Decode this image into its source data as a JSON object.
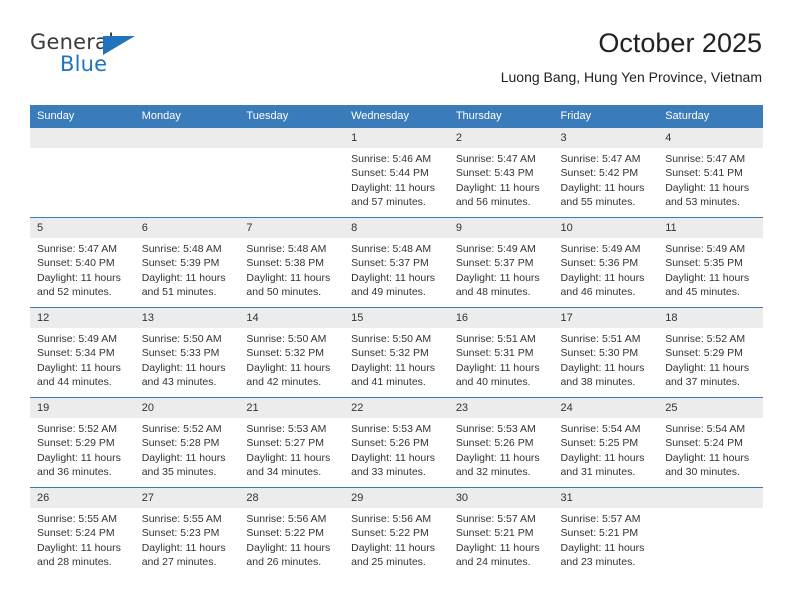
{
  "brand": {
    "name_part1": "General",
    "name_part2": "Blue",
    "accent_color": "#1f74bd"
  },
  "header": {
    "title": "October 2025",
    "subtitle": "Luong Bang, Hung Yen Province, Vietnam"
  },
  "calendar": {
    "header_bg": "#3a7cba",
    "daynum_bg": "#ececec",
    "weekday_headers": [
      "Sunday",
      "Monday",
      "Tuesday",
      "Wednesday",
      "Thursday",
      "Friday",
      "Saturday"
    ],
    "weeks": [
      [
        {
          "day": "",
          "sunrise": "",
          "sunset": "",
          "daylight_line1": "",
          "daylight_line2": ""
        },
        {
          "day": "",
          "sunrise": "",
          "sunset": "",
          "daylight_line1": "",
          "daylight_line2": ""
        },
        {
          "day": "",
          "sunrise": "",
          "sunset": "",
          "daylight_line1": "",
          "daylight_line2": ""
        },
        {
          "day": "1",
          "sunrise": "Sunrise: 5:46 AM",
          "sunset": "Sunset: 5:44 PM",
          "daylight_line1": "Daylight: 11 hours",
          "daylight_line2": "and 57 minutes."
        },
        {
          "day": "2",
          "sunrise": "Sunrise: 5:47 AM",
          "sunset": "Sunset: 5:43 PM",
          "daylight_line1": "Daylight: 11 hours",
          "daylight_line2": "and 56 minutes."
        },
        {
          "day": "3",
          "sunrise": "Sunrise: 5:47 AM",
          "sunset": "Sunset: 5:42 PM",
          "daylight_line1": "Daylight: 11 hours",
          "daylight_line2": "and 55 minutes."
        },
        {
          "day": "4",
          "sunrise": "Sunrise: 5:47 AM",
          "sunset": "Sunset: 5:41 PM",
          "daylight_line1": "Daylight: 11 hours",
          "daylight_line2": "and 53 minutes."
        }
      ],
      [
        {
          "day": "5",
          "sunrise": "Sunrise: 5:47 AM",
          "sunset": "Sunset: 5:40 PM",
          "daylight_line1": "Daylight: 11 hours",
          "daylight_line2": "and 52 minutes."
        },
        {
          "day": "6",
          "sunrise": "Sunrise: 5:48 AM",
          "sunset": "Sunset: 5:39 PM",
          "daylight_line1": "Daylight: 11 hours",
          "daylight_line2": "and 51 minutes."
        },
        {
          "day": "7",
          "sunrise": "Sunrise: 5:48 AM",
          "sunset": "Sunset: 5:38 PM",
          "daylight_line1": "Daylight: 11 hours",
          "daylight_line2": "and 50 minutes."
        },
        {
          "day": "8",
          "sunrise": "Sunrise: 5:48 AM",
          "sunset": "Sunset: 5:37 PM",
          "daylight_line1": "Daylight: 11 hours",
          "daylight_line2": "and 49 minutes."
        },
        {
          "day": "9",
          "sunrise": "Sunrise: 5:49 AM",
          "sunset": "Sunset: 5:37 PM",
          "daylight_line1": "Daylight: 11 hours",
          "daylight_line2": "and 48 minutes."
        },
        {
          "day": "10",
          "sunrise": "Sunrise: 5:49 AM",
          "sunset": "Sunset: 5:36 PM",
          "daylight_line1": "Daylight: 11 hours",
          "daylight_line2": "and 46 minutes."
        },
        {
          "day": "11",
          "sunrise": "Sunrise: 5:49 AM",
          "sunset": "Sunset: 5:35 PM",
          "daylight_line1": "Daylight: 11 hours",
          "daylight_line2": "and 45 minutes."
        }
      ],
      [
        {
          "day": "12",
          "sunrise": "Sunrise: 5:49 AM",
          "sunset": "Sunset: 5:34 PM",
          "daylight_line1": "Daylight: 11 hours",
          "daylight_line2": "and 44 minutes."
        },
        {
          "day": "13",
          "sunrise": "Sunrise: 5:50 AM",
          "sunset": "Sunset: 5:33 PM",
          "daylight_line1": "Daylight: 11 hours",
          "daylight_line2": "and 43 minutes."
        },
        {
          "day": "14",
          "sunrise": "Sunrise: 5:50 AM",
          "sunset": "Sunset: 5:32 PM",
          "daylight_line1": "Daylight: 11 hours",
          "daylight_line2": "and 42 minutes."
        },
        {
          "day": "15",
          "sunrise": "Sunrise: 5:50 AM",
          "sunset": "Sunset: 5:32 PM",
          "daylight_line1": "Daylight: 11 hours",
          "daylight_line2": "and 41 minutes."
        },
        {
          "day": "16",
          "sunrise": "Sunrise: 5:51 AM",
          "sunset": "Sunset: 5:31 PM",
          "daylight_line1": "Daylight: 11 hours",
          "daylight_line2": "and 40 minutes."
        },
        {
          "day": "17",
          "sunrise": "Sunrise: 5:51 AM",
          "sunset": "Sunset: 5:30 PM",
          "daylight_line1": "Daylight: 11 hours",
          "daylight_line2": "and 38 minutes."
        },
        {
          "day": "18",
          "sunrise": "Sunrise: 5:52 AM",
          "sunset": "Sunset: 5:29 PM",
          "daylight_line1": "Daylight: 11 hours",
          "daylight_line2": "and 37 minutes."
        }
      ],
      [
        {
          "day": "19",
          "sunrise": "Sunrise: 5:52 AM",
          "sunset": "Sunset: 5:29 PM",
          "daylight_line1": "Daylight: 11 hours",
          "daylight_line2": "and 36 minutes."
        },
        {
          "day": "20",
          "sunrise": "Sunrise: 5:52 AM",
          "sunset": "Sunset: 5:28 PM",
          "daylight_line1": "Daylight: 11 hours",
          "daylight_line2": "and 35 minutes."
        },
        {
          "day": "21",
          "sunrise": "Sunrise: 5:53 AM",
          "sunset": "Sunset: 5:27 PM",
          "daylight_line1": "Daylight: 11 hours",
          "daylight_line2": "and 34 minutes."
        },
        {
          "day": "22",
          "sunrise": "Sunrise: 5:53 AM",
          "sunset": "Sunset: 5:26 PM",
          "daylight_line1": "Daylight: 11 hours",
          "daylight_line2": "and 33 minutes."
        },
        {
          "day": "23",
          "sunrise": "Sunrise: 5:53 AM",
          "sunset": "Sunset: 5:26 PM",
          "daylight_line1": "Daylight: 11 hours",
          "daylight_line2": "and 32 minutes."
        },
        {
          "day": "24",
          "sunrise": "Sunrise: 5:54 AM",
          "sunset": "Sunset: 5:25 PM",
          "daylight_line1": "Daylight: 11 hours",
          "daylight_line2": "and 31 minutes."
        },
        {
          "day": "25",
          "sunrise": "Sunrise: 5:54 AM",
          "sunset": "Sunset: 5:24 PM",
          "daylight_line1": "Daylight: 11 hours",
          "daylight_line2": "and 30 minutes."
        }
      ],
      [
        {
          "day": "26",
          "sunrise": "Sunrise: 5:55 AM",
          "sunset": "Sunset: 5:24 PM",
          "daylight_line1": "Daylight: 11 hours",
          "daylight_line2": "and 28 minutes."
        },
        {
          "day": "27",
          "sunrise": "Sunrise: 5:55 AM",
          "sunset": "Sunset: 5:23 PM",
          "daylight_line1": "Daylight: 11 hours",
          "daylight_line2": "and 27 minutes."
        },
        {
          "day": "28",
          "sunrise": "Sunrise: 5:56 AM",
          "sunset": "Sunset: 5:22 PM",
          "daylight_line1": "Daylight: 11 hours",
          "daylight_line2": "and 26 minutes."
        },
        {
          "day": "29",
          "sunrise": "Sunrise: 5:56 AM",
          "sunset": "Sunset: 5:22 PM",
          "daylight_line1": "Daylight: 11 hours",
          "daylight_line2": "and 25 minutes."
        },
        {
          "day": "30",
          "sunrise": "Sunrise: 5:57 AM",
          "sunset": "Sunset: 5:21 PM",
          "daylight_line1": "Daylight: 11 hours",
          "daylight_line2": "and 24 minutes."
        },
        {
          "day": "31",
          "sunrise": "Sunrise: 5:57 AM",
          "sunset": "Sunset: 5:21 PM",
          "daylight_line1": "Daylight: 11 hours",
          "daylight_line2": "and 23 minutes."
        },
        {
          "day": "",
          "sunrise": "",
          "sunset": "",
          "daylight_line1": "",
          "daylight_line2": ""
        }
      ]
    ]
  }
}
